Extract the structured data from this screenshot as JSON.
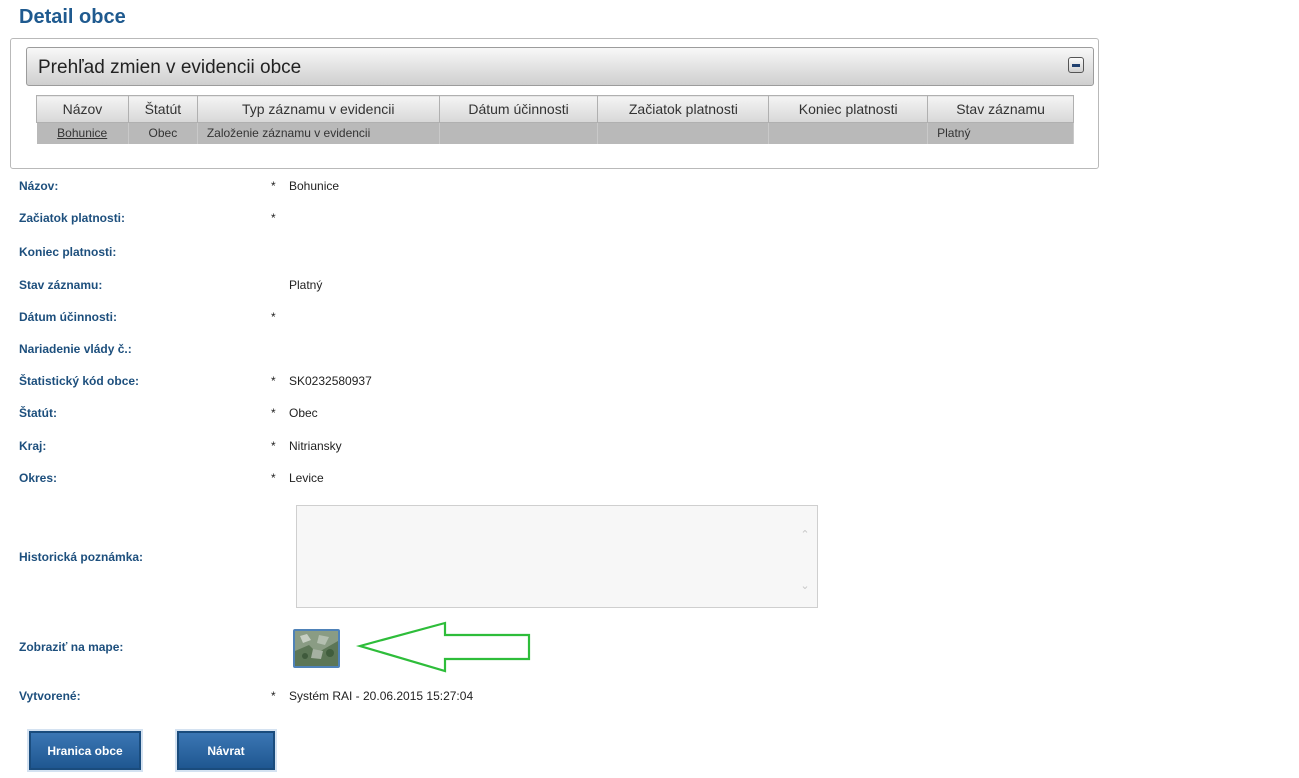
{
  "page": {
    "title": "Detail obce"
  },
  "panel": {
    "title": "Prehľad zmien v evidencii obce",
    "collapse_icon": "minus-icon"
  },
  "changes_table": {
    "columns": [
      "Názov",
      "Štatút",
      "Typ záznamu v evidencii",
      "Dátum účinnosti",
      "Začiatok platnosti",
      "Koniec platnosti",
      "Stav záznamu"
    ],
    "rows": [
      [
        "Bohunice",
        "Obec",
        "Založenie záznamu v evidencii",
        "",
        "",
        "",
        "Platný"
      ]
    ]
  },
  "form": {
    "nazov": {
      "label": "Názov:",
      "required": "*",
      "value": "Bohunice"
    },
    "zaciatok": {
      "label": "Začiatok platnosti:",
      "required": "*",
      "value": ""
    },
    "koniec": {
      "label": "Koniec platnosti:",
      "required": "",
      "value": ""
    },
    "stav": {
      "label": "Stav záznamu:",
      "required": "",
      "value": "Platný"
    },
    "datum": {
      "label": "Dátum účinnosti:",
      "required": "*",
      "value": ""
    },
    "nariadenie": {
      "label": "Nariadenie vlády č.:",
      "required": "",
      "value": ""
    },
    "statisticky_kod": {
      "label": "Štatistický kód obce:",
      "required": "*",
      "value": "SK0232580937"
    },
    "statut": {
      "label": "Štatút:",
      "required": "*",
      "value": "Obec"
    },
    "kraj": {
      "label": "Kraj:",
      "required": "*",
      "value": "Nitriansky"
    },
    "okres": {
      "label": "Okres:",
      "required": "*",
      "value": "Levice"
    },
    "poznamka": {
      "label": "Historická poznámka:",
      "value": ""
    },
    "mapa": {
      "label": "Zobraziť na mape:"
    },
    "vytvorene": {
      "label": "Vytvorené:",
      "required": "*",
      "value": "Systém RAI - 20.06.2015 15:27:04"
    }
  },
  "buttons": {
    "hranica": "Hranica obce",
    "navrat": "Návrat"
  },
  "colors": {
    "label": "#1d4f7d",
    "button": "#2a64a2",
    "arrow": "#2ebd3a"
  }
}
